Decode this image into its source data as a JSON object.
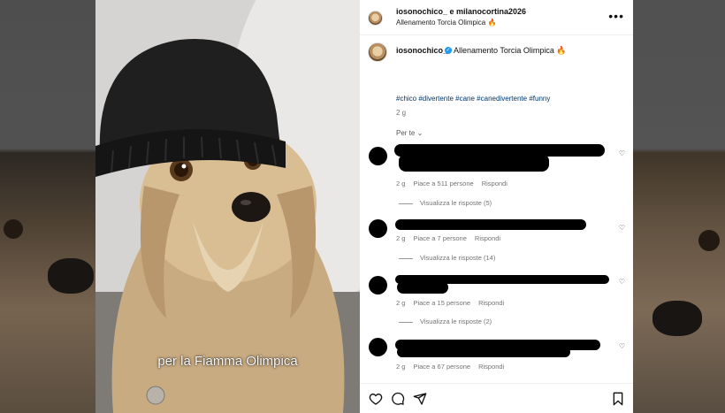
{
  "header": {
    "title": "iosonochico_ e milanocortina2026",
    "subtitle": "Allenamento Torcia Olimpica 🔥"
  },
  "caption": {
    "username": "iosonochico_",
    "text": "Allenamento Torcia Olimpica 🔥",
    "hashtags": "#chico #divertente #cane #canedivertente #funny",
    "age": "2 g"
  },
  "sort_label": "Per te ⌄",
  "video_caption": "per la Fiamma Olimpica",
  "comments": [
    {
      "age": "2 g",
      "likes": "Piace a 511 persone",
      "reply": "Rispondi",
      "replies": "Visualizza le risposte (5)"
    },
    {
      "age": "2 g",
      "likes": "Piace a 7 persone",
      "reply": "Rispondi",
      "replies": "Visualizza le risposte (14)"
    },
    {
      "age": "2 g",
      "likes": "Piace a 15 persone",
      "reply": "Rispondi",
      "replies": "Visualizza le risposte (2)"
    },
    {
      "age": "2 g",
      "likes": "Piace a 67 persone",
      "reply": "Rispondi"
    }
  ],
  "icons": {
    "more": "more-options-icon",
    "like": "heart-icon",
    "comment": "comment-icon",
    "share": "share-icon",
    "save": "bookmark-icon",
    "verified": "verified-badge-icon"
  },
  "colors": {
    "hashtag": "#00376b",
    "verified": "#1d9bf0",
    "meta": "#737373"
  }
}
